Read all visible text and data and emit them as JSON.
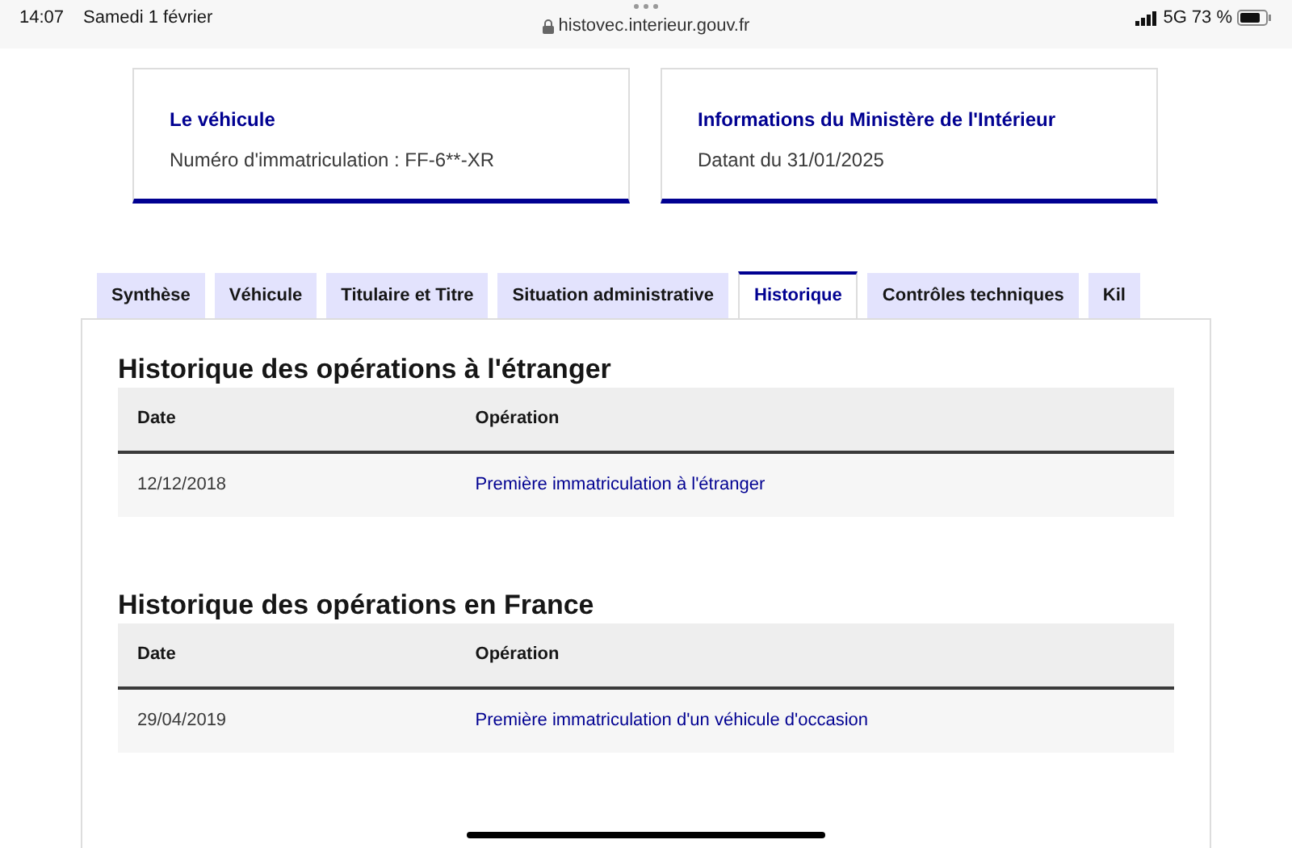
{
  "status_bar": {
    "time": "14:07",
    "date": "Samedi 1 février",
    "url": "histovec.interieur.gouv.fr",
    "network": "5G",
    "battery": "73 %"
  },
  "cards": [
    {
      "title": "Le véhicule",
      "text": "Numéro d'immatriculation : FF-6**-XR"
    },
    {
      "title": "Informations du Ministère de l'Intérieur",
      "text": "Datant du 31/01/2025"
    }
  ],
  "tabs": [
    {
      "label": "Synthèse",
      "selected": false
    },
    {
      "label": "Véhicule",
      "selected": false
    },
    {
      "label": "Titulaire et Titre",
      "selected": false
    },
    {
      "label": "Situation administrative",
      "selected": false
    },
    {
      "label": "Historique",
      "selected": true
    },
    {
      "label": "Contrôles techniques",
      "selected": false
    },
    {
      "label": "Kil",
      "selected": false
    }
  ],
  "sections": [
    {
      "title": "Historique des opérations à l'étranger",
      "columns": [
        "Date",
        "Opération"
      ],
      "rows": [
        [
          "12/12/2018",
          "Première immatriculation à l'étranger"
        ]
      ]
    },
    {
      "title": "Historique des opérations en France",
      "columns": [
        "Date",
        "Opération"
      ],
      "rows": [
        [
          "29/04/2019",
          "Première immatriculation d'un véhicule d'occasion"
        ]
      ]
    }
  ]
}
